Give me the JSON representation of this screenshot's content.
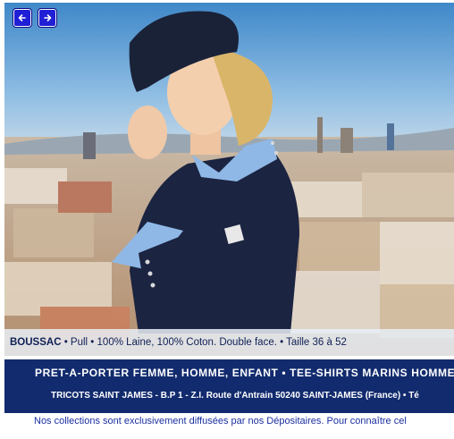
{
  "slideshow": {
    "prev_icon": "arrow-left-icon",
    "next_icon": "arrow-right-icon",
    "photo_subject": "woman-in-navy-sweater-over-city"
  },
  "caption": {
    "brand": "BOUSSAC",
    "details": " • Pull • 100% Laine, 100% Coton. Double face. • Taille 36 à 52"
  },
  "banner": {
    "line1": "PRET-A-PORTER FEMME, HOMME, ENFANT • TEE-SHIRTS MARINS HOMME",
    "line2": "TRICOTS SAINT JAMES - B.P 1 - Z.I. Route d'Antrain 50240 SAINT-JAMES (France) • Té"
  },
  "footer": {
    "text": "Nos collections sont exclusivement diffusées par nos Dépositaires. Pour connaître cel"
  },
  "colors": {
    "band": "#122b6e",
    "nav_button": "#1f1fd6",
    "caption_text": "#0f1f55",
    "footer_text": "#1b2fa0"
  }
}
